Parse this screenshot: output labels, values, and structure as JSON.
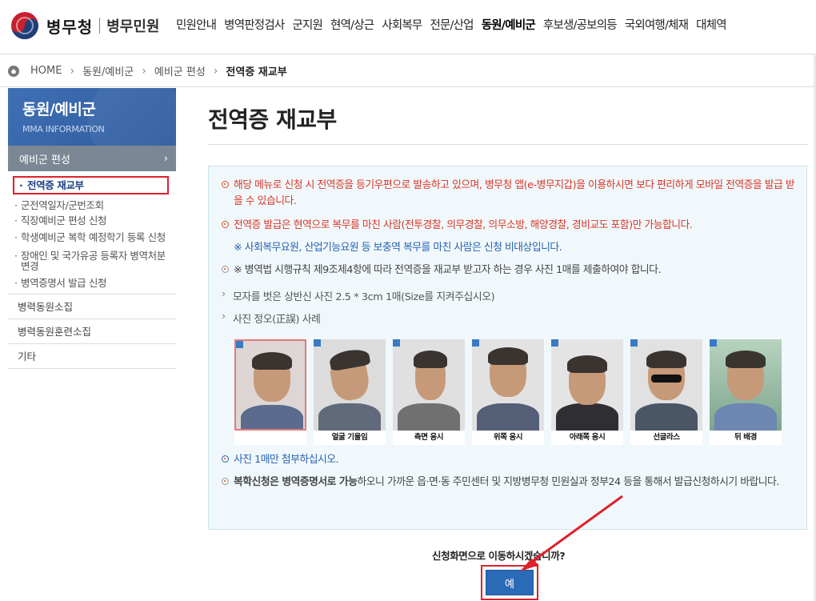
{
  "header": {
    "logo_main": "병무청",
    "logo_sub": "병무민원",
    "nav": [
      "민원안내",
      "병역판정검사",
      "군지원",
      "현역/상근",
      "사회복무",
      "전문/산업",
      "동원/예비군",
      "후보생/공보의등",
      "국외여행/체재",
      "대체역"
    ],
    "nav_active_index": 6
  },
  "breadcrumb": {
    "items": [
      "HOME",
      "동원/예비군",
      "예비군 편성",
      "전역증 재교부"
    ]
  },
  "sidebar": {
    "title": "동원/예비군",
    "subtitle": "MMA INFORMATION",
    "section": "예비군 편성",
    "items": [
      "전역증 재교부",
      "군전역일자/군번조회",
      "직장예비군 편성 신청",
      "학생예비군 복학 예정학기 등록 신청",
      "장애인 및 국가유공 등록자 병역처분변경",
      "병역증명서 발급 신청"
    ],
    "others": [
      "병력동원소집",
      "병력동원훈련소집",
      "기타"
    ]
  },
  "main": {
    "title": "전역증 재교부",
    "notice1": "해당 메뉴로 신청 시 전역증을 등기우편으로 발송하고 있으며, 병무청 앱(e-병무지갑)을 이용하시면 보다 편리하게 모바일 전역증을 발급 받을 수 있습니다.",
    "notice2": "전역증 발급은 현역으로 복무를 마친 사람(전투경찰, 의무경찰, 의무소방, 해양경찰, 경비교도 포함)만 가능합니다.",
    "notice2_sub": "※ 사회복무요원, 산업기능요원 등 보충역 복무를 마친 사람은 신청 비대상입니다.",
    "notice3": "※ 병역법 시행규칙 제9조제4항에 따라 전역증을 재교부 받고자 하는 경우 사진 1매를 제출하여야 합니다.",
    "sub1": "모자를 벗은 상반신 사진 2.5 * 3cm 1매(Size를 지켜주십시오)",
    "sub2": "사진 정오(正誤) 사례",
    "photo_captions": [
      "",
      "얼굴 기울임",
      "측면 응시",
      "위쪽 응시",
      "아래쪽 응시",
      "선글라스",
      "뒤 배경"
    ],
    "notice4": "사진 1매만 첨부하십시오.",
    "notice5_bold": "복학신청은 병역증명서로 가능",
    "notice5_rest": "하오니 가까운 읍·면·동 주민센터 및 지방병무청 민원실과 정부24 등을 통해서 발급신청하시기 바랍니다.",
    "confirm_text": "신청화면으로 이동하시겠습니까?",
    "yes_button": "예"
  }
}
